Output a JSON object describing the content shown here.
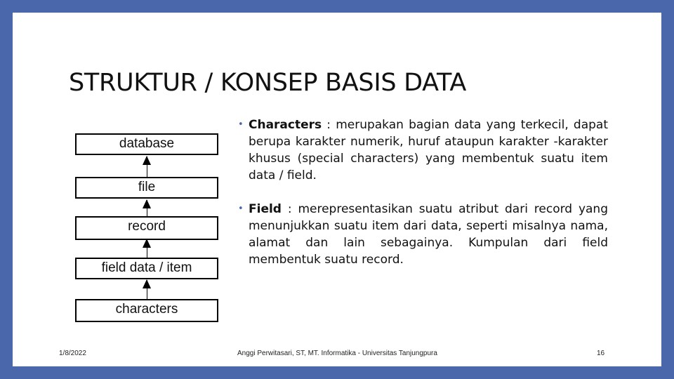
{
  "slide": {
    "title": "STRUKTUR / KONSEP BASIS DATA",
    "diagram": {
      "levels": [
        "database",
        "file",
        "record",
        "field data / item",
        "characters"
      ],
      "arrow_direction": "up"
    },
    "bullets": [
      {
        "term": "Characters",
        "separator": " : ",
        "text": "merupakan bagian data yang terkecil, dapat berupa karakter numerik, huruf ataupun karakter -karakter khusus (special characters) yang membentuk suatu item data / field."
      },
      {
        "term": "Field",
        "separator": " : ",
        "text": "merepresentasikan suatu atribut dari record yang menunjukkan suatu item dari data, seperti misalnya nama, alamat dan lain sebagainya. Kumpulan dari field membentuk suatu record."
      }
    ],
    "footer": {
      "date": "1/8/2022",
      "author": "Anggi Perwitasari, ST, MT. Informatika - Universitas Tanjungpura",
      "page_number": "16"
    }
  },
  "colors": {
    "frame": "#4a67ab",
    "background": "#ffffff",
    "text": "#111111"
  }
}
